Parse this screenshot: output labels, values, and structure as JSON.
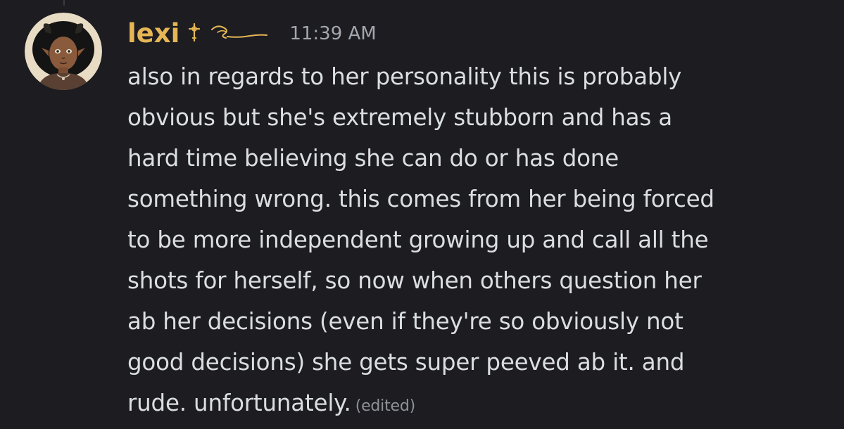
{
  "message": {
    "avatar_icon": "avatar-portrait-icon",
    "username": "lexi",
    "username_color": "#e6b655",
    "name_icons": [
      "cross-icon",
      "wave-icon"
    ],
    "timestamp": "11:39 AM",
    "lines": [
      "also in regards to her personality this is probably",
      "obvious but she's extremely stubborn and has a",
      "hard time believing she can do or has done",
      "something wrong. this comes from her being forced",
      "to be more independent growing up and call all the",
      "shots for herself, so now when others question her",
      "ab her decisions (even if they're so obviously not",
      "good decisions) she gets super peeved ab it. and",
      "rude. unfortunately."
    ],
    "edited_label": "(edited)"
  },
  "colors": {
    "background": "#1c1c21",
    "text": "#dbdee1",
    "timestamp": "#a3a6ad",
    "edited": "#8e9297"
  }
}
